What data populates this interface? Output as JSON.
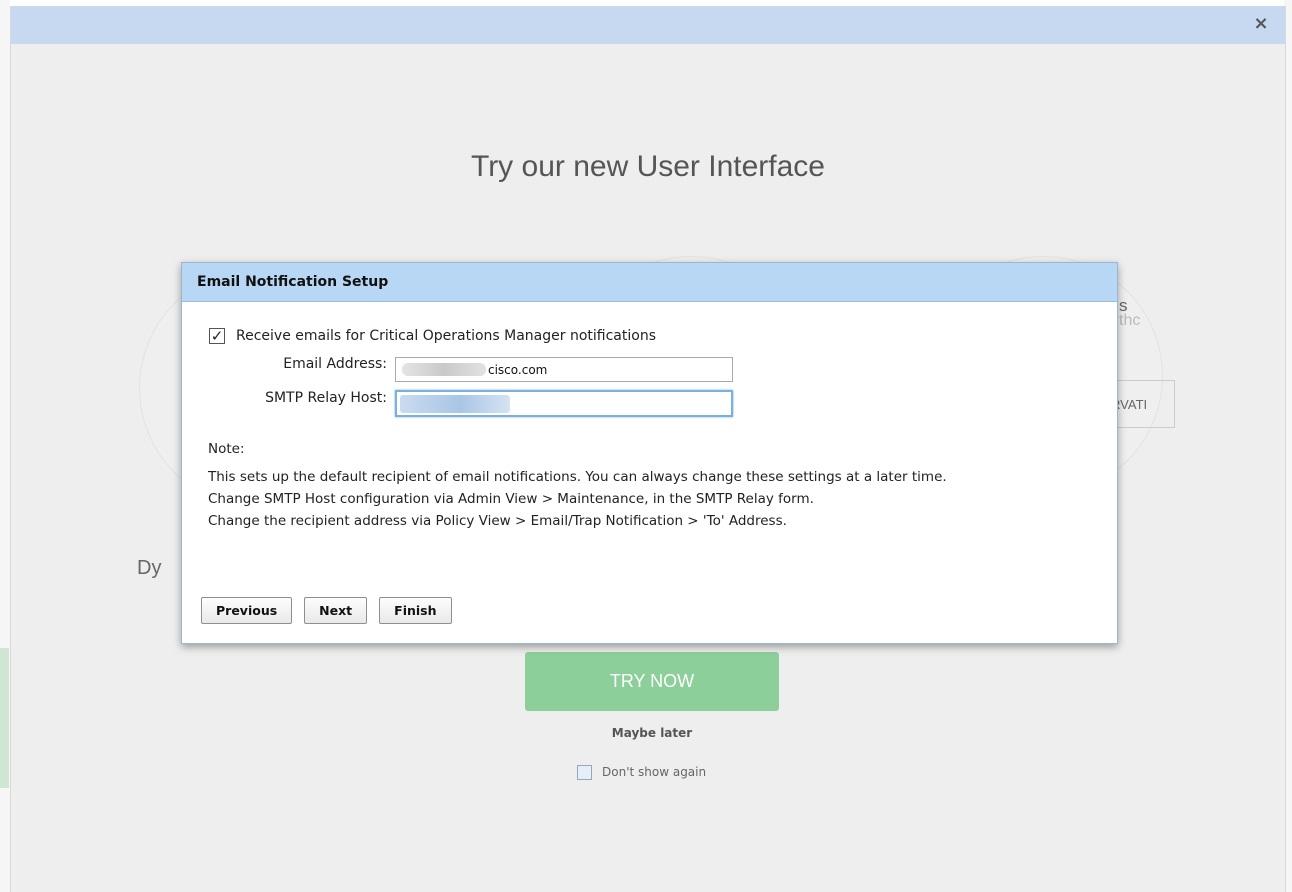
{
  "promo": {
    "title": "Try our new User Interface",
    "close_glyph": "×",
    "feature_text_right_1": "s",
    "feature_text_right_2": "thc",
    "feature_button_right": "RVATI",
    "feature_text_left": "Dy",
    "try_now_label": "TRY NOW",
    "maybe_later_label": "Maybe later",
    "dont_show_label": "Don't show again",
    "dont_show_checked": false
  },
  "dialog": {
    "title": "Email Notification Setup",
    "receive_checkbox": {
      "label": "Receive emails for Critical Operations Manager notifications",
      "checked": true,
      "check_glyph": "✓"
    },
    "email": {
      "label": "Email Address:",
      "value_visible": "cisco.com"
    },
    "smtp": {
      "label": "SMTP Relay Host:"
    },
    "note": {
      "title": "Note:",
      "lines": [
        "This sets up the default recipient of email notifications. You can always change these settings at a later time.",
        "Change SMTP Host configuration via Admin View > Maintenance, in the SMTP Relay form.",
        "Change the recipient address via Policy View > Email/Trap Notification > 'To' Address."
      ]
    },
    "buttons": {
      "previous": "Previous",
      "next": "Next",
      "finish": "Finish"
    }
  },
  "colors": {
    "promo_header": "#c6d9f0",
    "dialog_header": "#b8d7f5",
    "try_now": "#8dcf9a",
    "focus_border": "#7ab0e0"
  }
}
